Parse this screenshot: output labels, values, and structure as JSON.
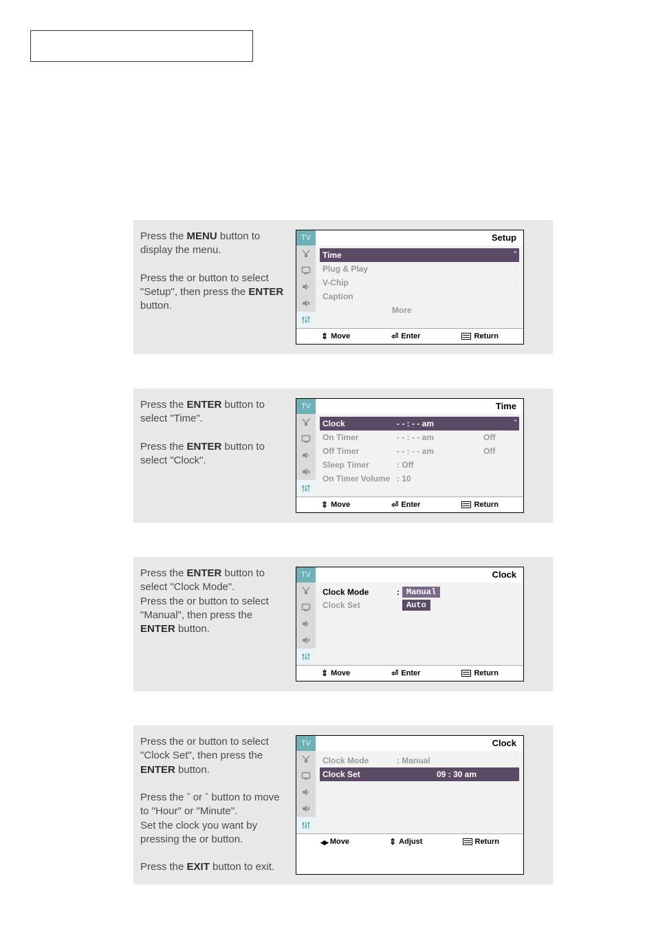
{
  "steps": [
    {
      "text_parts": [
        {
          "plain": "Press the "
        },
        {
          "bold": "MENU"
        },
        {
          "plain": " button to display the menu."
        },
        {
          "br": true
        },
        {
          "br": true
        },
        {
          "plain": "Press the   or   button to select \"Setup\", then press the "
        },
        {
          "bold": "ENTER"
        },
        {
          "plain": " button."
        }
      ],
      "menu": {
        "title": "Setup",
        "active_icon": 4,
        "rows": [
          {
            "lbl": "Time",
            "val": "",
            "opt": "",
            "arrow": "ˆ",
            "hi": true
          },
          {
            "lbl": "Plug & Play",
            "val": "",
            "opt": "",
            "arrow": "ˆ"
          },
          {
            "lbl": "V-Chip",
            "val": "",
            "opt": "",
            "arrow": "-"
          },
          {
            "lbl": "Caption",
            "val": "",
            "opt": "",
            "arrow": "-"
          },
          {
            "lbl": "More",
            "val": "",
            "opt": "",
            "more": true
          }
        ],
        "footer": [
          [
            "updown",
            "Move"
          ],
          [
            "enter",
            "Enter"
          ],
          [
            "menu",
            "Return"
          ]
        ]
      }
    },
    {
      "text_parts": [
        {
          "plain": "Press the "
        },
        {
          "bold": "ENTER"
        },
        {
          "plain": " button to select \"Time\"."
        },
        {
          "br": true
        },
        {
          "br": true
        },
        {
          "plain": "Press the "
        },
        {
          "bold": "ENTER"
        },
        {
          "plain": " button to select \"Clock\"."
        }
      ],
      "menu": {
        "title": "Time",
        "active_icon": 4,
        "rows": [
          {
            "lbl": "Clock",
            "val": "- - : - - am",
            "opt": "",
            "arrow": "ˆ",
            "hi": true
          },
          {
            "lbl": "On Timer",
            "val": "- - : - - am",
            "opt": "Off"
          },
          {
            "lbl": "Off Timer",
            "val": "- - : - - am",
            "opt": "Off"
          },
          {
            "lbl": "Sleep Timer",
            "val": ": Off",
            "opt": ""
          },
          {
            "lbl": "On Timer Volume",
            "val": ": 10",
            "opt": ""
          }
        ],
        "footer": [
          [
            "updown",
            "Move"
          ],
          [
            "enter",
            "Enter"
          ],
          [
            "menu",
            "Return"
          ]
        ]
      }
    },
    {
      "text_parts": [
        {
          "plain": "Press the "
        },
        {
          "bold": "ENTER"
        },
        {
          "plain": " button to select \"Clock Mode\"."
        },
        {
          "br": true
        },
        {
          "plain": "Press the   or   button to select \"Manual\", then press the "
        },
        {
          "bold": "ENTER"
        },
        {
          "plain": " button."
        }
      ],
      "menu": {
        "title": "Clock",
        "active_icon": 4,
        "rows_custom": "clock_mode_dropdown",
        "rows": [
          {
            "lbl": "Clock Mode",
            "colon": ":",
            "drop": [
              "Manual",
              "Auto"
            ],
            "drop_sel": 0
          },
          {
            "lbl": "Clock Set"
          }
        ],
        "footer": [
          [
            "updown",
            "Move"
          ],
          [
            "enter",
            "Enter"
          ],
          [
            "menu",
            "Return"
          ]
        ]
      }
    },
    {
      "text_parts": [
        {
          "plain": "Press the   or   button to select \"Clock Set\", then press the "
        },
        {
          "bold": "ENTER"
        },
        {
          "plain": " button."
        },
        {
          "br": true
        },
        {
          "br": true
        },
        {
          "plain": "Press the ˇ or ˆ button to move to \"Hour\" or \"Minute\"."
        },
        {
          "br": true
        },
        {
          "plain": "Set the clock you want by pressing the   or   button."
        },
        {
          "br": true
        },
        {
          "br": true
        },
        {
          "plain": "Press the "
        },
        {
          "bold": "EXIT"
        },
        {
          "plain": " button to exit."
        }
      ],
      "menu": {
        "title": "Clock",
        "active_icon": 4,
        "rows_custom": "clock_set",
        "rows": [
          {
            "lbl": "Clock Mode",
            "val": ":  Manual",
            "arrow": "ˆ"
          },
          {
            "lbl": "Clock Set",
            "val": "09 : 30  am",
            "hi": true
          }
        ],
        "footer": [
          [
            "lr",
            "Move"
          ],
          [
            "updown",
            "Adjust"
          ],
          [
            "menu",
            "Return"
          ]
        ]
      }
    }
  ],
  "icons": [
    "antenna",
    "screen",
    "speaker",
    "mute",
    "sliders"
  ]
}
